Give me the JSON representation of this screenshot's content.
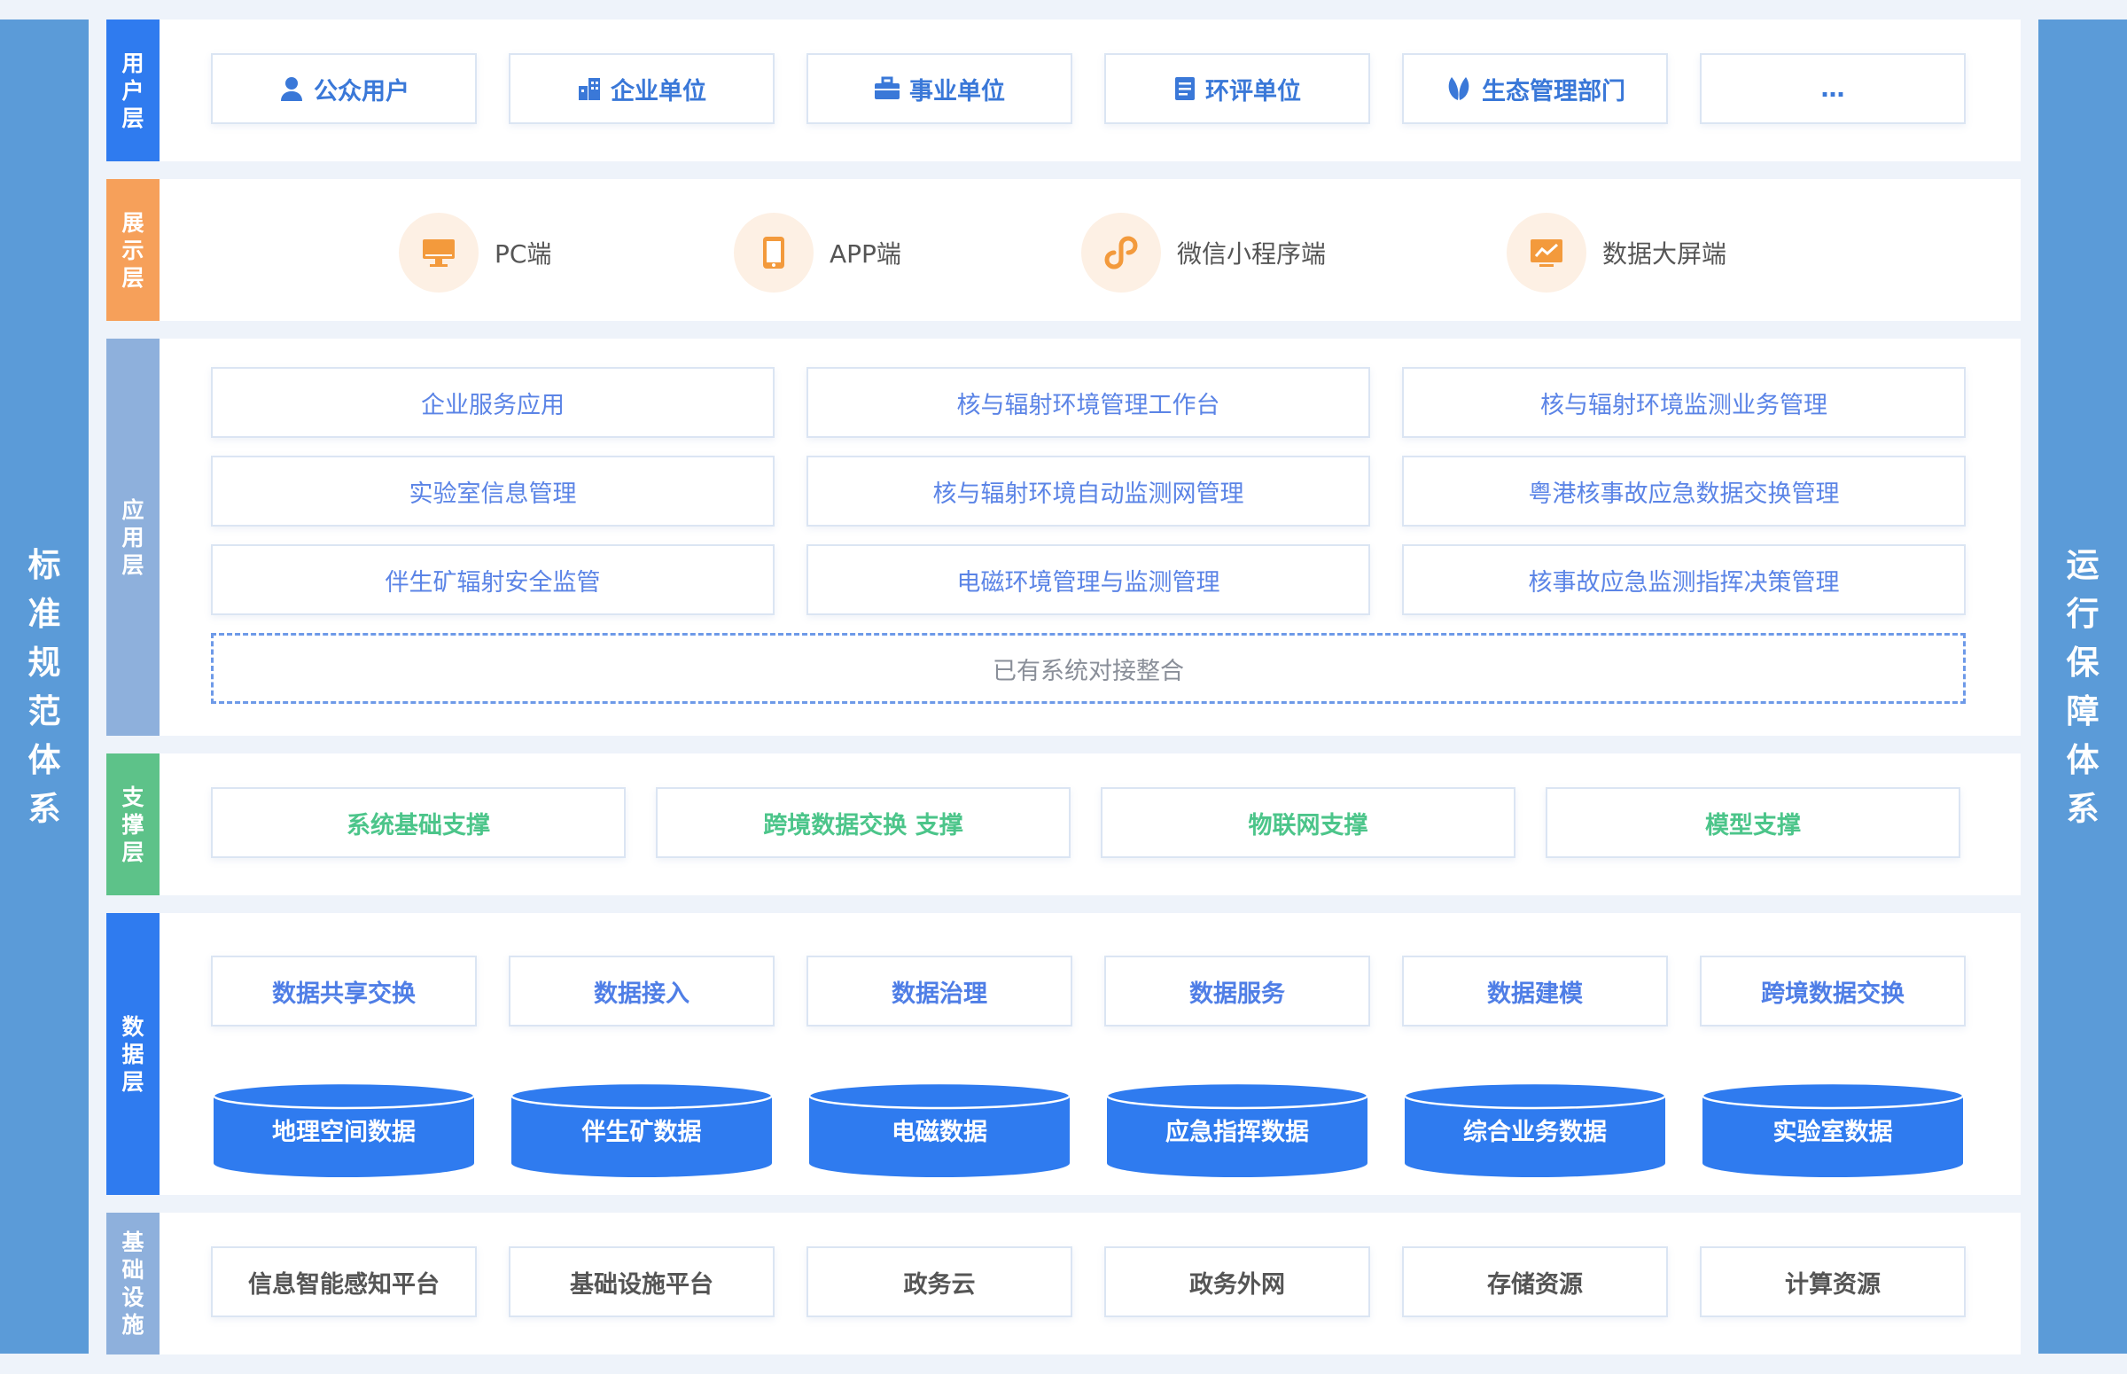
{
  "left_side": {
    "label": "标准规范体系"
  },
  "right_side": {
    "label": "运行保障体系"
  },
  "layers": {
    "user": {
      "tab": "用户层",
      "items": [
        {
          "label": "公众用户",
          "icon": "person-icon"
        },
        {
          "label": "企业单位",
          "icon": "building-icon"
        },
        {
          "label": "事业单位",
          "icon": "briefcase-icon"
        },
        {
          "label": "环评单位",
          "icon": "document-icon"
        },
        {
          "label": "生态管理部门",
          "icon": "leaf-icon"
        },
        {
          "label": "…",
          "icon": ""
        }
      ]
    },
    "display": {
      "tab": "展示层",
      "items": [
        {
          "label": "PC端",
          "icon": "monitor-icon"
        },
        {
          "label": "APP端",
          "icon": "phone-icon"
        },
        {
          "label": "微信小程序端",
          "icon": "miniprogram-icon"
        },
        {
          "label": "数据大屏端",
          "icon": "chart-screen-icon"
        }
      ]
    },
    "application": {
      "tab": "应用层",
      "items": [
        "企业服务应用",
        "核与辐射环境管理工作台",
        "核与辐射环境监测业务管理",
        "实验室信息管理",
        "核与辐射环境自动监测网管理",
        "粤港核事故应急数据交换管理",
        "伴生矿辐射安全监管",
        "电磁环境管理与监测管理",
        "核事故应急监测指挥决策管理"
      ],
      "integration": "已有系统对接整合"
    },
    "support": {
      "tab": "支撑层",
      "items": [
        "系统基础支撑",
        "跨境数据交换 支撑",
        "物联网支撑",
        "模型支撑"
      ]
    },
    "data": {
      "tab": "数据层",
      "services": [
        "数据共享交换",
        "数据接入",
        "数据治理",
        "数据服务",
        "数据建模",
        "跨境数据交换"
      ],
      "stores": [
        "地理空间数据",
        "伴生矿数据",
        "电磁数据",
        "应急指挥数据",
        "综合业务数据",
        "实验室数据"
      ]
    },
    "infra": {
      "tab": "基础设施",
      "items": [
        "信息智能感知平台",
        "基础设施平台",
        "政务云",
        "政务外网",
        "存储资源",
        "计算资源"
      ]
    }
  },
  "colors": {
    "side": "#5b9bd8",
    "user_tab": "#2f7bef",
    "display_tab": "#f6a05a",
    "application_tab": "#8eb0dc",
    "support_tab": "#5dc289",
    "data_tab": "#2f7bef",
    "infra_tab": "#8eb0dc",
    "cylinder": "#2f7bef",
    "display_icon": "#f39a3c"
  }
}
